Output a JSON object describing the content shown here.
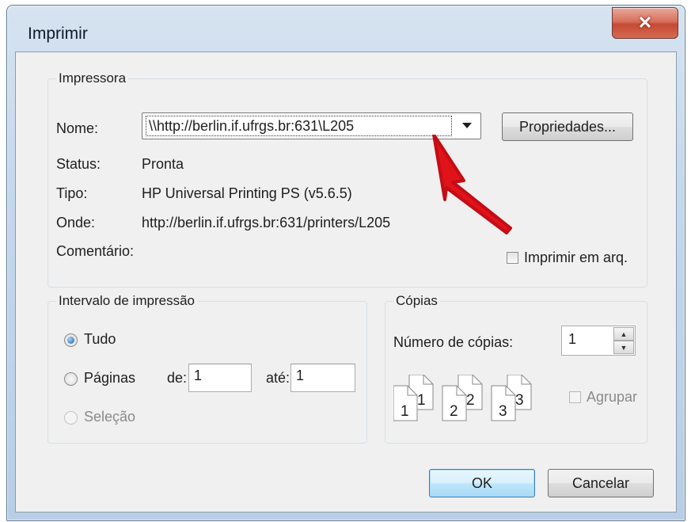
{
  "window": {
    "title": "Imprimir"
  },
  "printer": {
    "group_label": "Impressora",
    "name_label": "Nome:",
    "name_value": "\\\\http://berlin.if.ufrgs.br:631\\L205",
    "properties_button": "Propriedades...",
    "status_label": "Status:",
    "status_value": "Pronta",
    "type_label": "Tipo:",
    "type_value": "HP Universal Printing PS (v5.6.5)",
    "where_label": "Onde:",
    "where_value": "http://berlin.if.ufrgs.br:631/printers/L205",
    "comment_label": "Comentário:",
    "print_to_file": "Imprimir em arq."
  },
  "range": {
    "group_label": "Intervalo de impressão",
    "all": "Tudo",
    "pages": "Páginas",
    "from_label": "de:",
    "from_value": "1",
    "to_label": "até:",
    "to_value": "1",
    "selection": "Seleção",
    "selected": "all"
  },
  "copies": {
    "group_label": "Cópias",
    "count_label": "Número de cópias:",
    "count_value": "1",
    "collate": "Agrupar",
    "collate_checked": false
  },
  "buttons": {
    "ok": "OK",
    "cancel": "Cancelar"
  },
  "colors": {
    "annotation_arrow": "#e0121a",
    "accent": "#3c7fb1"
  }
}
